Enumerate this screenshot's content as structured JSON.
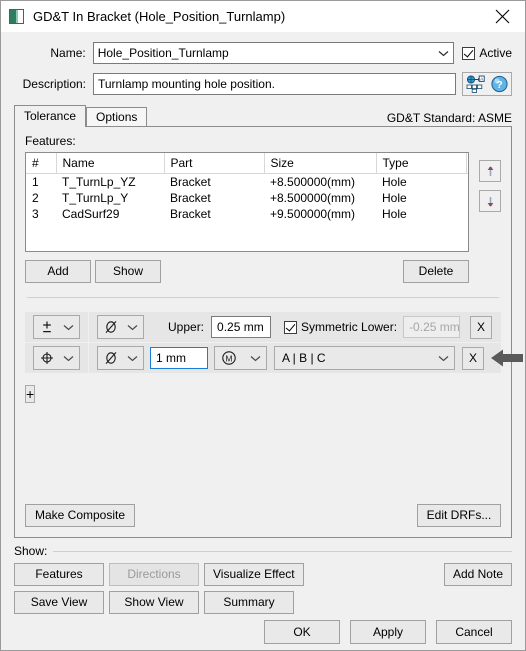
{
  "window": {
    "title": "GD&T In Bracket (Hole_Position_Turnlamp)",
    "icon": "app-icon",
    "close_icon": "close-icon"
  },
  "form": {
    "name_label": "Name:",
    "name_value": "Hole_Position_Turnlamp",
    "active_label": "Active",
    "active_checked": true,
    "description_label": "Description:",
    "description_value": "Turnlamp mounting hole position.",
    "translate_icon": "translate-icon",
    "help_icon": "help-icon"
  },
  "tabs": {
    "items": [
      {
        "label": "Tolerance",
        "active": true
      },
      {
        "label": "Options",
        "active": false
      }
    ],
    "standard_text": "GD&T Standard: ASME"
  },
  "features": {
    "label": "Features:",
    "columns": [
      "#",
      "Name",
      "Part",
      "Size",
      "Type"
    ],
    "rows": [
      {
        "num": "1",
        "name": "T_TurnLp_YZ",
        "part": "Bracket",
        "size": "+8.500000(mm)",
        "type": "Hole"
      },
      {
        "num": "2",
        "name": "T_TurnLp_Y",
        "part": "Bracket",
        "size": "+8.500000(mm)",
        "type": "Hole"
      },
      {
        "num": "3",
        "name": "CadSurf29",
        "part": "Bracket",
        "size": "+9.500000(mm)",
        "type": "Hole"
      }
    ],
    "move_up_icon": "arrow-up-icon",
    "move_down_icon": "arrow-down-icon",
    "add_label": "Add",
    "show_label": "Show",
    "delete_label": "Delete"
  },
  "tolerance_rows": [
    {
      "symbol_icon": "plus-minus-symbol",
      "modifier_icon": "diameter-symbol",
      "upper_label": "Upper:",
      "upper_value": "0.25 mm",
      "symmetric_label": "Symmetric Lower:",
      "symmetric_checked": true,
      "lower_value": "-0.25 mm",
      "remove_label": "X"
    },
    {
      "symbol_icon": "position-symbol",
      "modifier_icon": "diameter-symbol",
      "value": "1 mm",
      "material_icon": "mmc-symbol",
      "datum_value": "A | B | C",
      "remove_label": "X",
      "pointer_icon": "left-arrow-pointer"
    }
  ],
  "add_row_label": "+",
  "composite": {
    "make_composite_label": "Make Composite",
    "edit_drfs_label": "Edit DRFs..."
  },
  "show_group": {
    "label": "Show:",
    "buttons": [
      {
        "label": "Features",
        "disabled": false
      },
      {
        "label": "Directions",
        "disabled": true
      },
      {
        "label": "Visualize Effect",
        "disabled": false
      },
      {
        "label": "Save View",
        "disabled": false
      },
      {
        "label": "Show View",
        "disabled": false
      },
      {
        "label": "Summary",
        "disabled": false
      }
    ],
    "add_note_label": "Add Note"
  },
  "footer": {
    "ok_label": "OK",
    "apply_label": "Apply",
    "cancel_label": "Cancel"
  },
  "colors": {
    "dialog_bg": "#f0f0f0",
    "titlebar_bg": "#ffffff",
    "focus_border": "#1a7fd4",
    "icon_green": "#2f7d5f"
  }
}
